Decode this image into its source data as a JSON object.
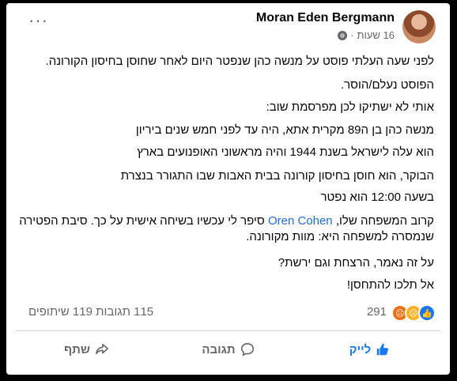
{
  "post": {
    "author": "Moran Eden Bergmann",
    "time": "16 שעות",
    "dot": "·",
    "more_label": "···",
    "paragraphs": {
      "p1": "לפני שעה העלתי פוסט על מנשה כהן שנפטר היום לאחר שחוסן בחיסון הקורונה.",
      "p2": "הפוסט נעלם/הוסר.",
      "p3": "אותי לא ישתיקו לכן מפרסמת שוב:",
      "p4": "מנשה כהן בן ה89 מקרית אתא, היה עד לפני חמש שנים ביריון",
      "p5": "הוא עלה לישראל בשנת 1944 והיה מראשוני האופנועים בארץ",
      "p6": "הבוקר, הוא חוסן בחיסון קורונה בבית האבות שבו התגורר בנצרת",
      "p7": "בשעה 12:00 הוא נפטר",
      "p8_before": "קרוב המשפחה שלו, ",
      "p8_tag": "Oren Cohen",
      "p8_after": " סיפר לי עכשיו בשיחה אישית על כך. סיבת הפטירה שנמסרה למשפחה היא: מוות מקורונה.",
      "p9": "על זה נאמר, הרצחת וגם ירשת?",
      "p10": "אל תלכו להתחסן!"
    }
  },
  "stats": {
    "reactions_count": "291",
    "comments_shares": "115 תגובות 119 שיתופים",
    "reaction_icons": [
      "like-icon",
      "sad-icon",
      "angry-icon"
    ]
  },
  "actions": {
    "like": "לייק",
    "comment": "תגובה",
    "share": "שתף"
  },
  "colors": {
    "accent": "#1877f2",
    "text": "#050505",
    "secondary": "#65676b"
  }
}
